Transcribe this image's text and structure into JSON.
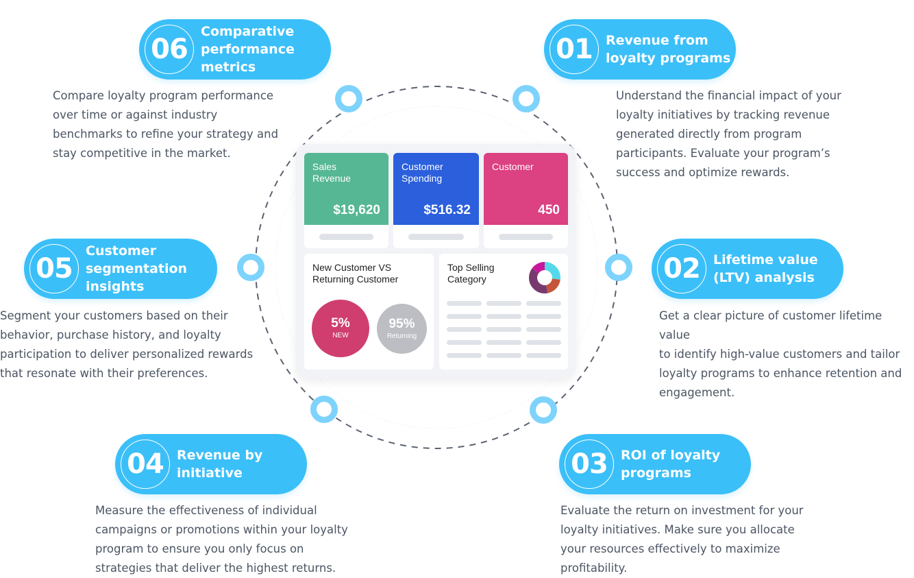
{
  "steps": [
    {
      "number": "01",
      "title": "Revenue from\nloyalty programs",
      "description": "Understand the financial impact of your\nloyalty initiatives by tracking revenue\ngenerated directly from program\nparticipants. Evaluate your program’s\nsuccess and optimize rewards."
    },
    {
      "number": "02",
      "title": "Lifetime value\n(LTV) analysis",
      "description": "Get a clear picture of customer lifetime value\nto identify high-value customers and tailor\nloyalty programs to enhance retention and\nengagement."
    },
    {
      "number": "03",
      "title": "ROI of loyalty\nprograms",
      "description": "Evaluate the return on investment for your\nloyalty initiatives. Make sure you allocate\nyour resources effectively to maximize\nprofitability."
    },
    {
      "number": "04",
      "title": "Revenue by\ninitiative",
      "description": "Measure the effectiveness of individual\ncampaigns or promotions within your loyalty\nprogram to ensure you only focus on\nstrategies that deliver the highest returns."
    },
    {
      "number": "05",
      "title": "Customer\nsegmentation\ninsights",
      "description": "Segment your customers based on their\nbehavior, purchase history, and loyalty\nparticipation to deliver personalized rewards\nthat resonate with their preferences."
    },
    {
      "number": "06",
      "title": "Comparative\nperformance\nmetrics",
      "description": "Compare loyalty program performance\nover time or against industry\nbenchmarks to refine your strategy and\nstay competitive in the market."
    }
  ],
  "dashboard": {
    "kpis": [
      {
        "label": "Sales\nRevenue",
        "value": "$19,620",
        "color": "#56b794"
      },
      {
        "label": "Customer\nSpending",
        "value": "$516.32",
        "color": "#2b5fdc"
      },
      {
        "label": "Customer",
        "value": "450",
        "color": "#dc4182"
      }
    ],
    "new_vs_returning": {
      "title": "New Customer VS\nReturning Customer",
      "new": {
        "percent": "5%",
        "label": "NEW",
        "color": "#cf3e6f"
      },
      "returning": {
        "percent": "95%",
        "label": "Returning",
        "color": "#bcbec3"
      }
    },
    "top_selling": {
      "title": "Top Selling\nCategory",
      "donut_segments": [
        {
          "name": "cyan",
          "share": 0.27,
          "color": "#55d9ea"
        },
        {
          "name": "orange",
          "share": 0.2,
          "color": "#c4553a"
        },
        {
          "name": "purple",
          "share": 0.38,
          "color": "#763a6e"
        },
        {
          "name": "magenta",
          "share": 0.15,
          "color": "#c8189b"
        }
      ]
    }
  },
  "colors": {
    "accent": "#3bbff8",
    "dot_ring": "#7dd3fc",
    "text": "#4b5563"
  }
}
